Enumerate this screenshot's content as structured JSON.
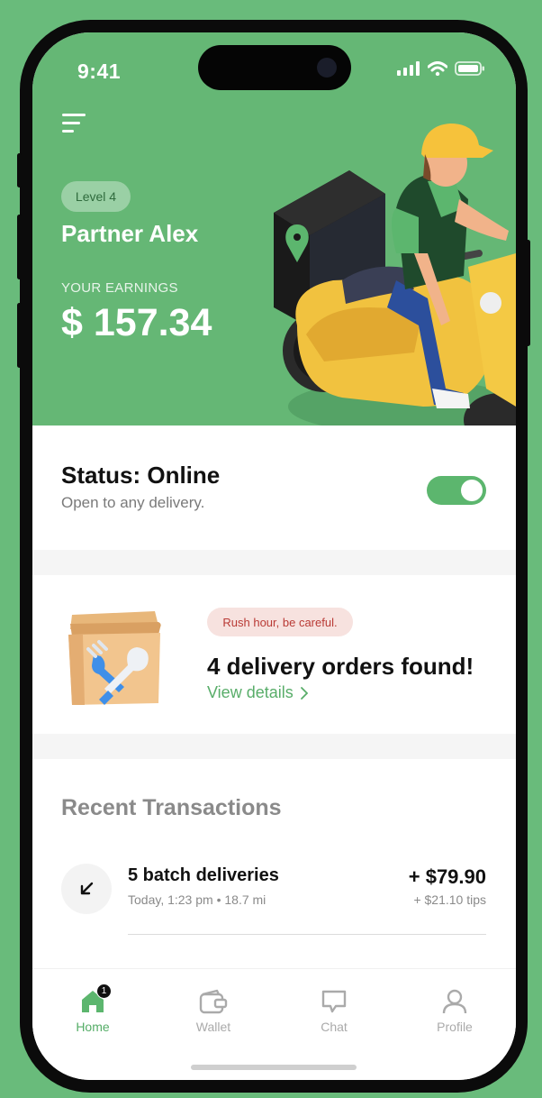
{
  "status_bar": {
    "time": "9:41"
  },
  "hero": {
    "level_badge": "Level 4",
    "partner_name": "Partner Alex",
    "earnings_label": "YOUR EARNINGS",
    "earnings_value": "$ 157.34"
  },
  "status_card": {
    "title": "Status: Online",
    "subtitle": "Open to any delivery.",
    "toggle_on": true
  },
  "orders_card": {
    "badge": "Rush hour, be careful.",
    "title": "4 delivery orders found!",
    "link": "View details"
  },
  "transactions": {
    "heading": "Recent Transactions",
    "items": [
      {
        "title": "5 batch deliveries",
        "meta": "Today, 1:23 pm • 18.7 mi",
        "amount": "+ $79.90",
        "tips": "+ $21.10 tips"
      }
    ]
  },
  "tabbar": {
    "tabs": [
      {
        "label": "Home",
        "icon": "home-icon",
        "badge": "1",
        "active": true
      },
      {
        "label": "Wallet",
        "icon": "wallet-icon",
        "active": false
      },
      {
        "label": "Chat",
        "icon": "chat-icon",
        "active": false
      },
      {
        "label": "Profile",
        "icon": "profile-icon",
        "active": false
      }
    ]
  },
  "colors": {
    "brand_green": "#65b775",
    "accent_green": "#58ad69",
    "rush_badge_bg": "#f7e2df",
    "rush_badge_text": "#b93a35"
  }
}
